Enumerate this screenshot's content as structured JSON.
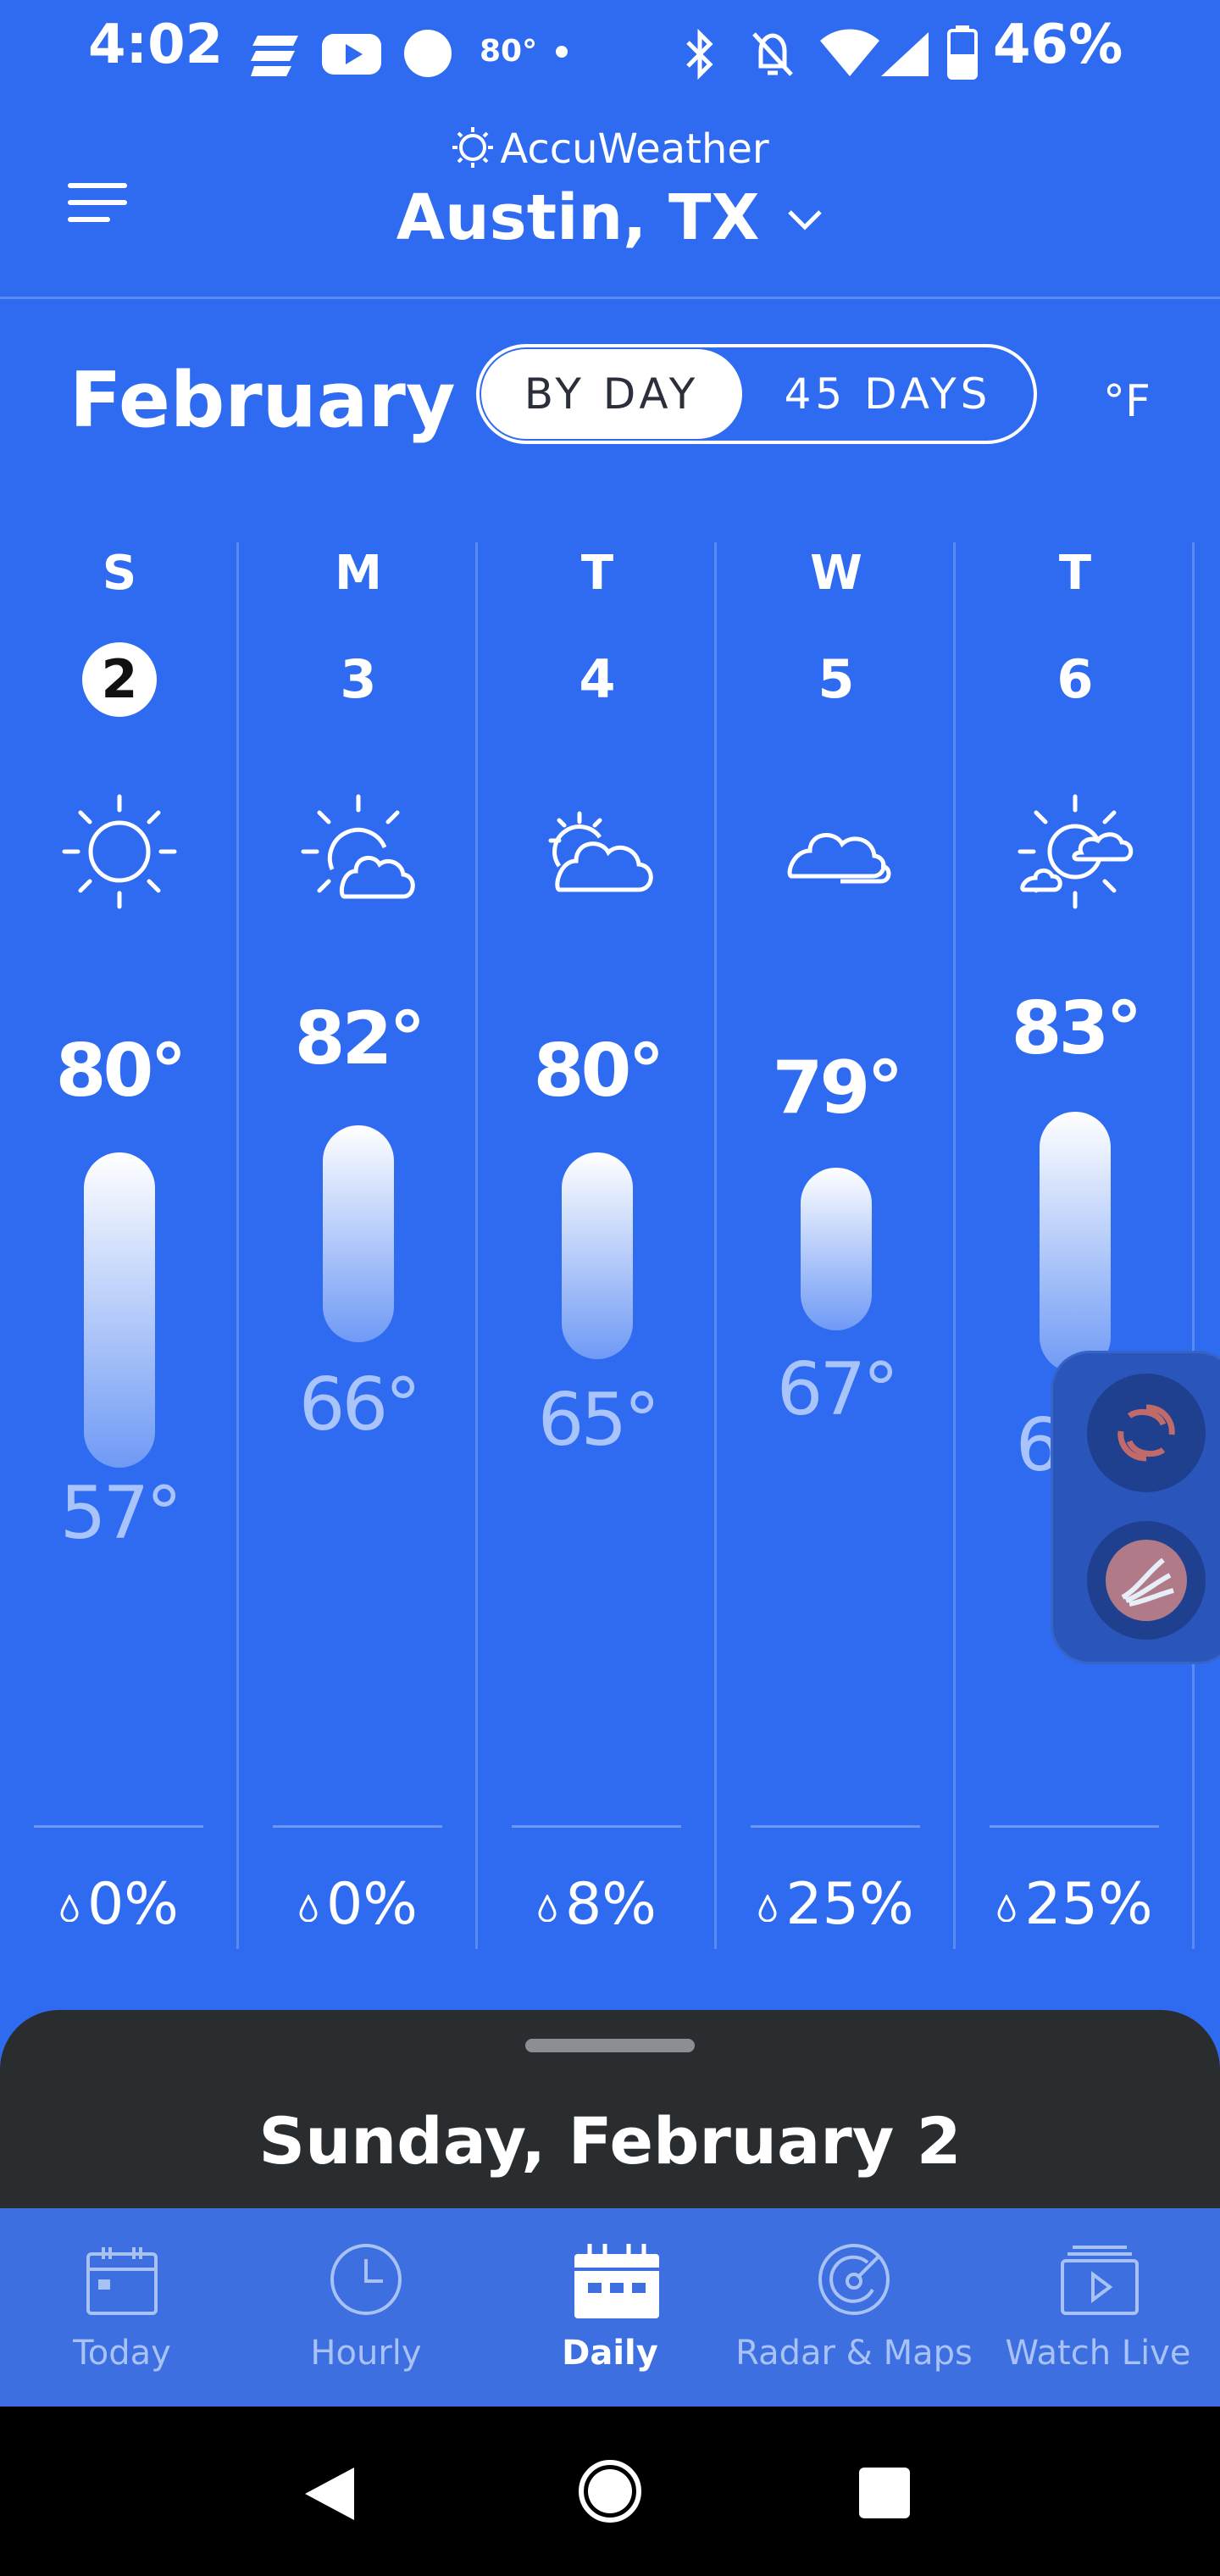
{
  "status_bar": {
    "time": "4:02",
    "temp": "80°",
    "battery": "46%",
    "icons": [
      "news-icon",
      "youtube-icon",
      "circle-icon",
      "dot-icon",
      "bluetooth-icon",
      "bell-off-icon",
      "wifi-icon",
      "signal-icon",
      "battery-icon"
    ]
  },
  "header": {
    "brand": "AccuWeather",
    "location": "Austin, TX"
  },
  "controls": {
    "month": "February",
    "toggle": [
      "BY DAY",
      "45 DAYS"
    ],
    "active_toggle": "BY DAY",
    "unit": "°F"
  },
  "days": [
    {
      "dow": "S",
      "date": "2",
      "icon": "sunny-icon",
      "hi": "80°",
      "lo": "57°",
      "precip": "0%",
      "selected": true
    },
    {
      "dow": "M",
      "date": "3",
      "icon": "mostly-sunny-icon",
      "hi": "82°",
      "lo": "66°",
      "precip": "0%",
      "selected": false
    },
    {
      "dow": "T",
      "date": "4",
      "icon": "partly-sunny-icon",
      "hi": "80°",
      "lo": "65°",
      "precip": "8%",
      "selected": false
    },
    {
      "dow": "W",
      "date": "5",
      "icon": "cloudy-icon",
      "hi": "79°",
      "lo": "67°",
      "precip": "25%",
      "selected": false
    },
    {
      "dow": "T",
      "date": "6",
      "icon": "partly-sunny-showers-icon",
      "hi": "83°",
      "lo": "64°",
      "precip": "25%",
      "selected": false
    }
  ],
  "sheet": {
    "title": "Sunday, February 2"
  },
  "nav": [
    {
      "label": "Today",
      "icon": "calendar-today-icon",
      "active": false
    },
    {
      "label": "Hourly",
      "icon": "clock-icon",
      "active": false
    },
    {
      "label": "Daily",
      "icon": "calendar-daily-icon",
      "active": true
    },
    {
      "label": "Radar & Maps",
      "icon": "radar-icon",
      "active": false
    },
    {
      "label": "Watch Live",
      "icon": "tv-play-icon",
      "active": false
    }
  ],
  "system_nav": [
    "back-icon",
    "home-icon",
    "recents-icon"
  ],
  "colors": {
    "background": "#2f6bf0",
    "sheet": "#2a2d30",
    "nav": "#3d6fe0"
  }
}
